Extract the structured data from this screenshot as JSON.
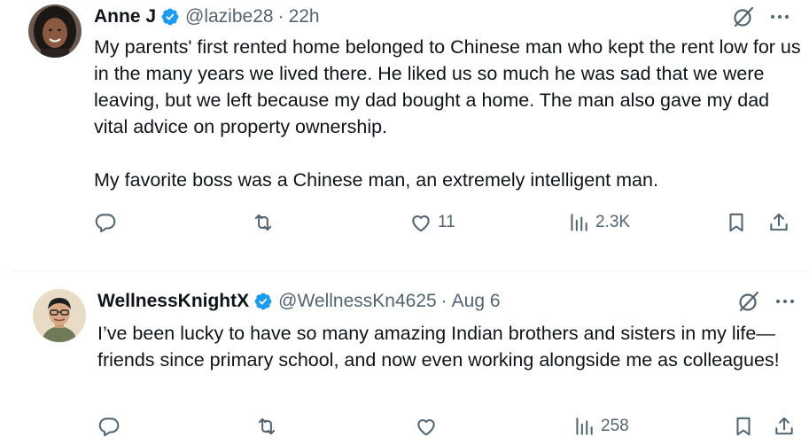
{
  "tweets": [
    {
      "author": "Anne J",
      "handle": "@lazibe28",
      "separator": "·",
      "time": "22h",
      "text": "My parents' first rented home belonged to Chinese man who kept the rent low for us in the many years we lived there. He liked us so much he was sad that we were leaving, but we left because my dad bought a home. The man also gave my dad vital advice on property ownership.\n\nMy favorite boss was a Chinese man, an extremely intelligent man.",
      "replies": "",
      "reposts": "",
      "likes": "11",
      "views": "2.3K"
    },
    {
      "author": "WellnessKnightX",
      "handle": "@WellnessKn4625",
      "separator": "·",
      "time": "Aug 6",
      "text": "I’ve been lucky to have so many amazing Indian brothers and sisters in my life—friends since primary school, and now even working alongside me as colleagues!",
      "replies": "",
      "reposts": "",
      "likes": "",
      "views": "258"
    }
  ],
  "colors": {
    "verified": "#1d9bf0",
    "muted": "#536471",
    "text": "#0f1419",
    "divider": "#eff3f4"
  },
  "icons": [
    "verified-badge-icon",
    "grok-icon",
    "more-icon",
    "reply-icon",
    "repost-icon",
    "like-icon",
    "views-icon",
    "bookmark-icon",
    "share-icon"
  ]
}
